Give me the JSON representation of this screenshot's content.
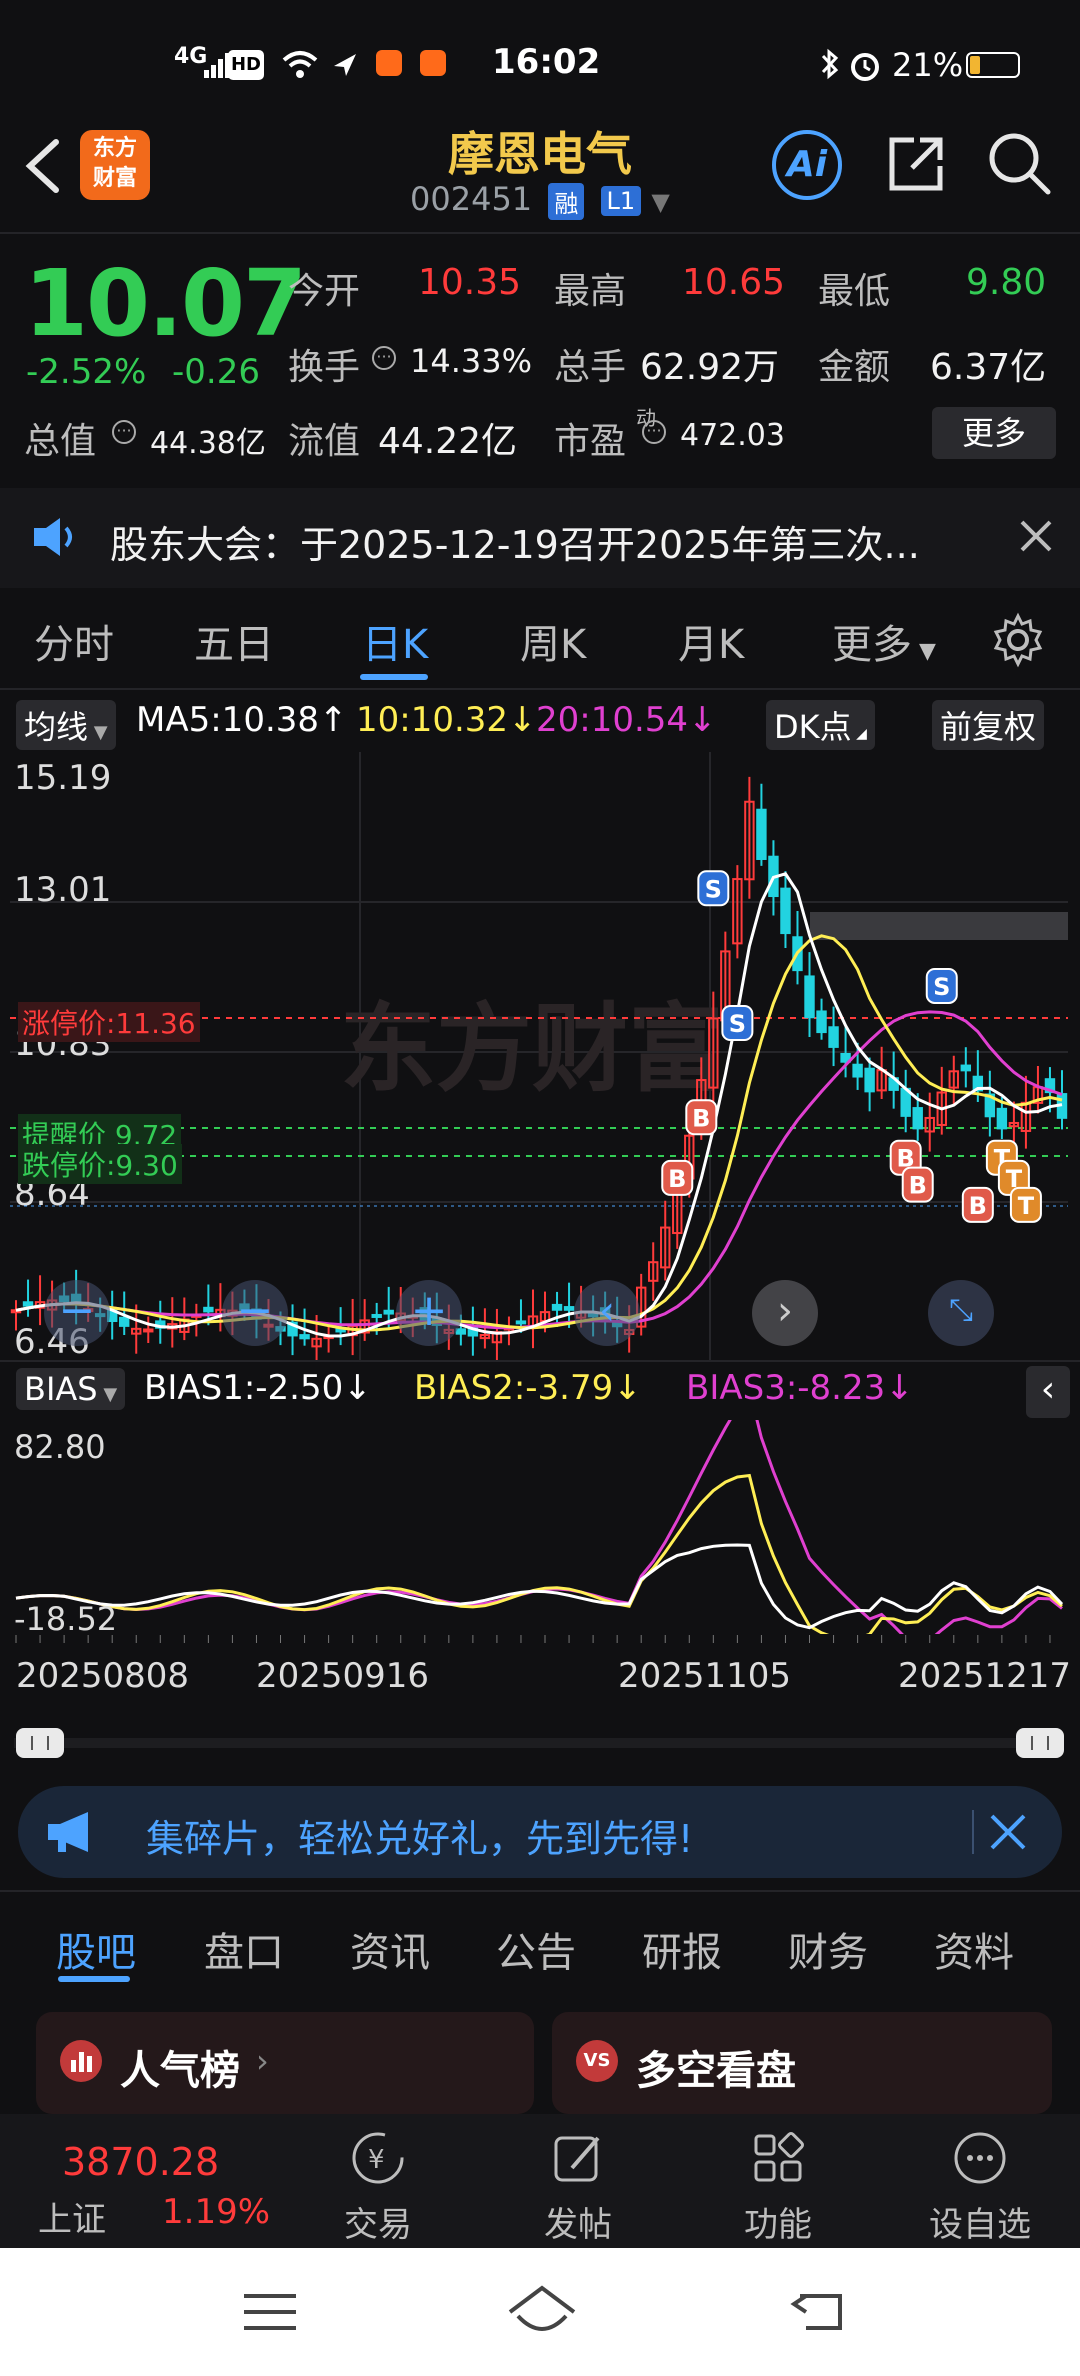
{
  "status_bar": {
    "time": "16:02",
    "network": "4G",
    "battery": "21%"
  },
  "header": {
    "logo_text_1": "东方",
    "logo_text_2": "财富",
    "title": "摩恩电气",
    "code": "002451",
    "badge_rong": "融",
    "badge_level": "L1",
    "ai_label": "Ai"
  },
  "quote": {
    "price": "10.07",
    "change_pct": "-2.52%",
    "change_amt": "-0.26",
    "open_label": "今开",
    "open": "10.35",
    "high_label": "最高",
    "high": "10.65",
    "low_label": "最低",
    "low": "9.80",
    "turnover_label": "换手",
    "turnover": "14.33%",
    "volume_label": "总手",
    "volume": "62.92万",
    "amount_label": "金额",
    "amount": "6.37亿",
    "mktcap_label": "总值",
    "mktcap": "44.38亿",
    "float_label": "流值",
    "float": "44.22亿",
    "pe_label": "市盈",
    "pe_sup": "动",
    "pe": "472.03",
    "more_label": "更多"
  },
  "notice": {
    "text": "股东大会：于2025-12-19召开2025年第三次..."
  },
  "kline_tabs": [
    "分时",
    "五日",
    "日K",
    "周K",
    "月K",
    "更多"
  ],
  "ma_bar": {
    "selector": "均线",
    "ma5": "MA5:10.38",
    "ma10": "10:10.32",
    "ma20": "20:10.54",
    "dk": "DK点",
    "adjust": "前复权"
  },
  "chart_labels": {
    "y1": "15.19",
    "y2": "13.01",
    "y3": "10.83",
    "y4": "8.64",
    "y5": "6.46",
    "limit_up": "涨停价:11.36",
    "remind": "提醒价 9.72",
    "limit_down": "跌停价:9.30",
    "watermark": "东方财富"
  },
  "bias_bar": {
    "selector": "BIAS",
    "bias1": "BIAS1:-2.50",
    "bias2": "BIAS2:-3.79",
    "bias3": "BIAS3:-8.23",
    "top": "82.80",
    "bottom": "-18.52"
  },
  "x_dates": [
    "20250808",
    "20250916",
    "20251105",
    "20251217"
  ],
  "promo": {
    "text": "集碎片，轻松兑好礼，先到先得!"
  },
  "bottom_tabs": [
    "股吧",
    "盘口",
    "资讯",
    "公告",
    "研报",
    "财务",
    "资料"
  ],
  "cards": {
    "left": "人气榜",
    "right": "多空看盘"
  },
  "toolbar": {
    "index_value": "3870.28",
    "index_name": "上证",
    "index_change": "1.19%",
    "trade": "交易",
    "post": "发帖",
    "function": "功能",
    "watchlist": "设自选"
  },
  "colors": {
    "up": "#ff3b3b",
    "down": "#33cc55",
    "accent": "#4da3ff",
    "ma5": "#ffffff",
    "ma10": "#ffee55",
    "ma20": "#e040d0"
  }
}
